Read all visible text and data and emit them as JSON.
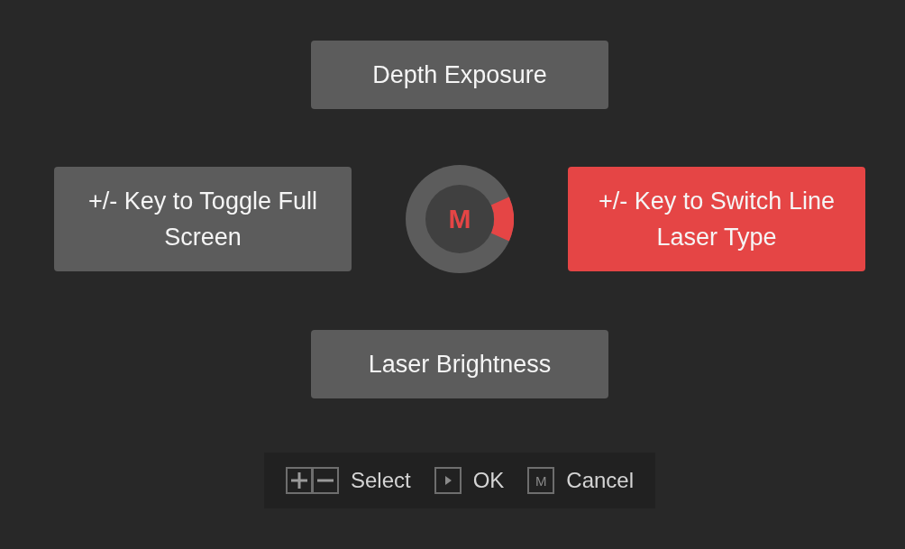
{
  "menu": {
    "options": {
      "top": {
        "label": "Depth Exposure",
        "selected": false
      },
      "left": {
        "label": "+/- Key to Toggle Full Screen",
        "selected": false
      },
      "right": {
        "label": "+/- Key to Switch Line Laser Type",
        "selected": true
      },
      "bottom": {
        "label": "Laser Brightness",
        "selected": false
      }
    },
    "dial": {
      "label": "M"
    }
  },
  "hint_bar": [
    {
      "kind": "plus-minus",
      "label": "Select"
    },
    {
      "kind": "play",
      "label": "OK"
    },
    {
      "kind": "key",
      "key": "M",
      "label": "Cancel"
    }
  ]
}
